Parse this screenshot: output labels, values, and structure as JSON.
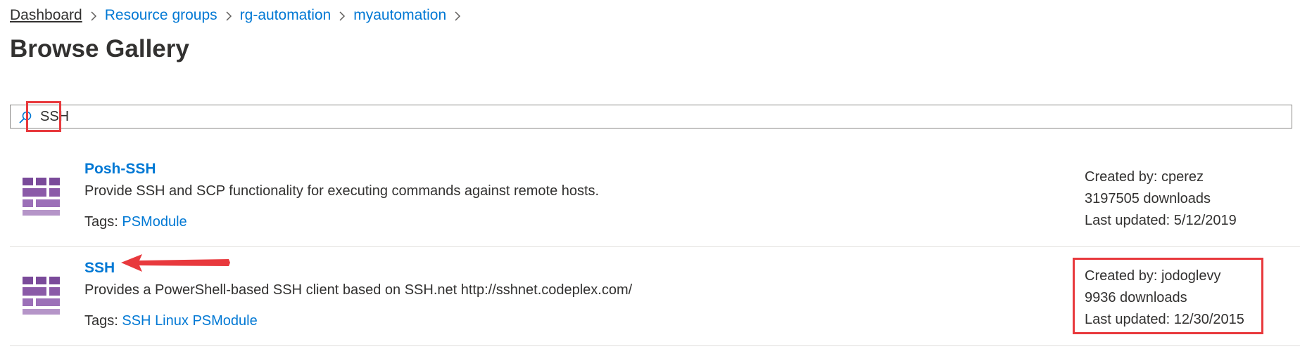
{
  "breadcrumb": [
    "Dashboard",
    "Resource groups",
    "rg-automation",
    "myautomation"
  ],
  "page_title": "Browse Gallery",
  "search": {
    "value": "SSH",
    "icon": "search-icon"
  },
  "results": [
    {
      "title": "Posh-SSH",
      "description": "Provide SSH and SCP functionality for executing commands against remote hosts.",
      "tags_label": "Tags:",
      "tags": [
        "PSModule"
      ],
      "created_by": "Created by: cperez",
      "downloads": "3197505 downloads",
      "last_updated": "Last updated: 5/12/2019"
    },
    {
      "title": "SSH",
      "description": "Provides a PowerShell-based SSH client based on SSH.net http://sshnet.codeplex.com/",
      "tags_label": "Tags:",
      "tags": [
        "SSH",
        "Linux",
        "PSModule"
      ],
      "created_by": "Created by: jodoglevy",
      "downloads": "9936 downloads",
      "last_updated": "Last updated: 12/30/2015"
    }
  ],
  "colors": {
    "accent": "#0078d4",
    "highlight": "#e8393d",
    "icon_dark": "#7a4a9a",
    "icon_light": "#b595c8"
  }
}
